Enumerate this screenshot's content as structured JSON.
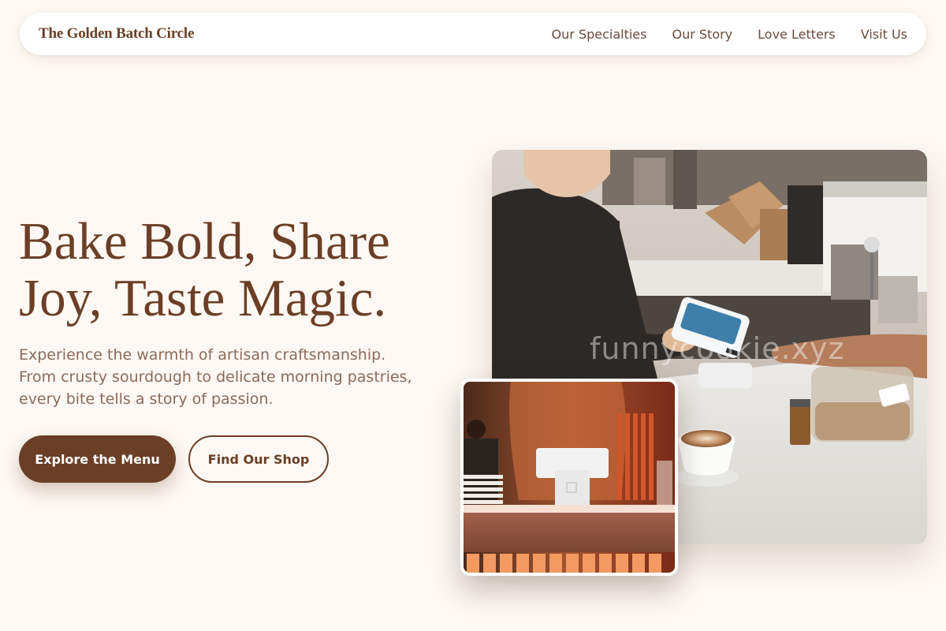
{
  "header": {
    "brand": "The Golden Batch Circle",
    "nav": [
      {
        "label": "Our Specialties"
      },
      {
        "label": "Our Story"
      },
      {
        "label": "Love Letters"
      },
      {
        "label": "Visit Us"
      }
    ]
  },
  "hero": {
    "title_line1": "Bake Bold, Share",
    "title_line2": "Joy, Taste Magic.",
    "subtitle_line1": "Experience the warmth of artisan craftsmanship.",
    "subtitle_line2": "From crusty sourdough to delicate morning pastries,",
    "subtitle_line3": "every bite tells a story of passion.",
    "primary_button": "Explore the Menu",
    "secondary_button": "Find Our Shop"
  },
  "images": {
    "main_watermark": "funnycookie.xyz",
    "main_description_icon": "cafe-counter-photo",
    "inset_description_icon": "register-counter-photo"
  },
  "colors": {
    "brand_brown": "#6b3f26",
    "background": "#fdf8f3",
    "body_text": "#8a6b5a"
  }
}
